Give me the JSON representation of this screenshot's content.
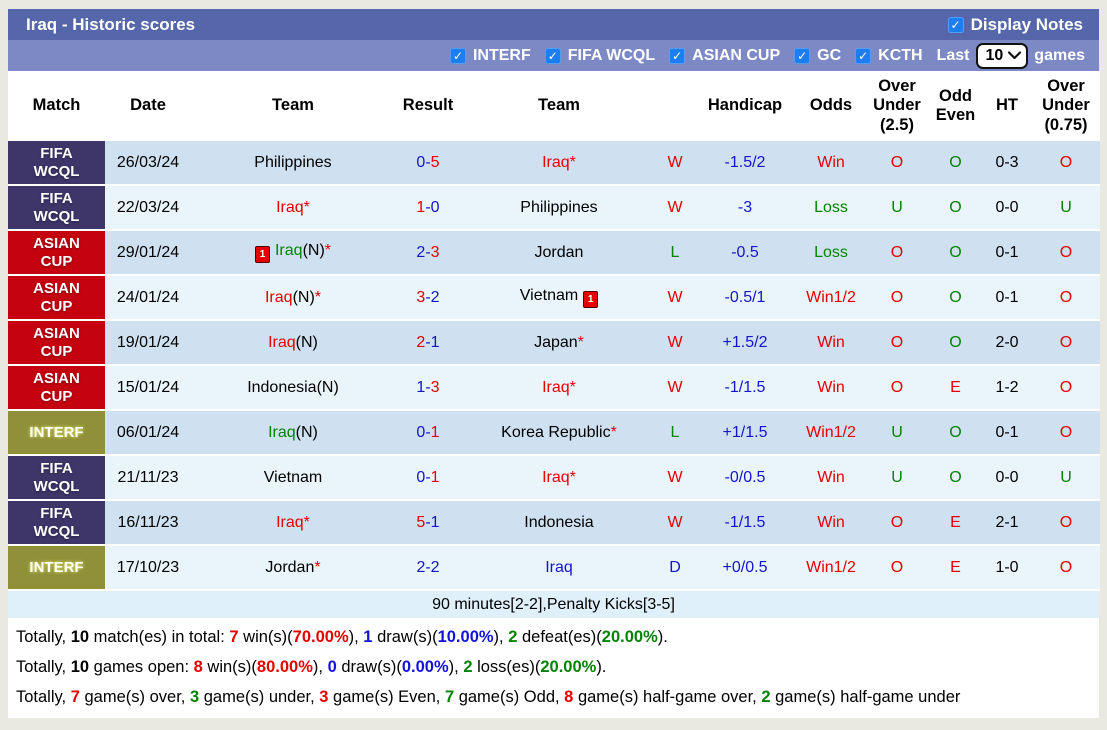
{
  "header": {
    "title": "Iraq - Historic scores",
    "display_notes_label": "Display Notes",
    "display_notes_checked": true
  },
  "filters": {
    "competitions": [
      "INTERF",
      "FIFA WCQL",
      "ASIAN CUP",
      "GC",
      "KCTH"
    ],
    "all_checked": true,
    "last_label": "Last",
    "last_value": "10",
    "games_label": "games"
  },
  "colors": {
    "win_red": "#e50000",
    "loss_green": "#028402",
    "draw_blue": "#1414c8",
    "badge_fifa_wcql": "#3e3569",
    "badge_asian_cup": "#c50210",
    "badge_interf": "#8f9039",
    "title_bar": "#5567aa",
    "filter_bar": "#7d89c5",
    "row_dark": "#cfe1f1",
    "row_light": "#e9f4fb",
    "checkbox_blue": "#1d7ef2"
  },
  "icons": {
    "red_card_text": "1",
    "checkbox_check": "✓"
  },
  "table": {
    "columns": [
      "Match",
      "Date",
      "Team",
      "Result",
      "Team",
      "",
      "Handicap",
      "Odds",
      "Over Under (2.5)",
      "Odd Even",
      "HT",
      "Over Under (0.75)"
    ],
    "note": "90 minutes[2-2],Penalty Kicks[3-5]",
    "rows": [
      {
        "comp_type": "fifa",
        "comp_lines": [
          "FIFA",
          "WCQL"
        ],
        "date": "26/03/24",
        "home": [
          {
            "t": "Philippines",
            "c": "k"
          }
        ],
        "home_icon": false,
        "result": [
          {
            "t": "0-",
            "c": "b"
          },
          {
            "t": "5",
            "c": "r"
          }
        ],
        "away": [
          {
            "t": "Iraq",
            "c": "r"
          },
          {
            "t": "*",
            "c": "r"
          }
        ],
        "away_icon": false,
        "wdl": {
          "t": "W",
          "c": "r"
        },
        "handicap": "-1.5/2",
        "odds": {
          "t": "Win",
          "c": "r"
        },
        "ou25": {
          "t": "O",
          "c": "r"
        },
        "oe": {
          "t": "O",
          "c": "g"
        },
        "ht": "0-3",
        "ou075": {
          "t": "O",
          "c": "r"
        }
      },
      {
        "comp_type": "fifa",
        "comp_lines": [
          "FIFA",
          "WCQL"
        ],
        "date": "22/03/24",
        "home": [
          {
            "t": "Iraq",
            "c": "r"
          },
          {
            "t": "*",
            "c": "r"
          }
        ],
        "home_icon": false,
        "result": [
          {
            "t": "1",
            "c": "r"
          },
          {
            "t": "-0",
            "c": "b"
          }
        ],
        "away": [
          {
            "t": "Philippines",
            "c": "k"
          }
        ],
        "away_icon": false,
        "wdl": {
          "t": "W",
          "c": "r"
        },
        "handicap": "-3",
        "odds": {
          "t": "Loss",
          "c": "g"
        },
        "ou25": {
          "t": "U",
          "c": "g"
        },
        "oe": {
          "t": "O",
          "c": "g"
        },
        "ht": "0-0",
        "ou075": {
          "t": "U",
          "c": "g"
        }
      },
      {
        "comp_type": "asian",
        "comp_lines": [
          "ASIAN",
          "CUP"
        ],
        "date": "29/01/24",
        "home": [
          {
            "t": "Iraq",
            "c": "g"
          },
          {
            "t": "(N)",
            "c": "k"
          },
          {
            "t": "*",
            "c": "r"
          }
        ],
        "home_icon": true,
        "result": [
          {
            "t": "2-",
            "c": "b"
          },
          {
            "t": "3",
            "c": "r"
          }
        ],
        "away": [
          {
            "t": "Jordan",
            "c": "k"
          }
        ],
        "away_icon": false,
        "wdl": {
          "t": "L",
          "c": "g"
        },
        "handicap": "-0.5",
        "odds": {
          "t": "Loss",
          "c": "g"
        },
        "ou25": {
          "t": "O",
          "c": "r"
        },
        "oe": {
          "t": "O",
          "c": "g"
        },
        "ht": "0-1",
        "ou075": {
          "t": "O",
          "c": "r"
        }
      },
      {
        "comp_type": "asian",
        "comp_lines": [
          "ASIAN",
          "CUP"
        ],
        "date": "24/01/24",
        "home": [
          {
            "t": "Iraq",
            "c": "r"
          },
          {
            "t": "(N)",
            "c": "k"
          },
          {
            "t": "*",
            "c": "r"
          }
        ],
        "home_icon": false,
        "result": [
          {
            "t": "3",
            "c": "r"
          },
          {
            "t": "-2",
            "c": "b"
          }
        ],
        "away": [
          {
            "t": "Vietnam",
            "c": "k"
          }
        ],
        "away_icon": true,
        "wdl": {
          "t": "W",
          "c": "r"
        },
        "handicap": "-0.5/1",
        "odds": {
          "t": "Win1/2",
          "c": "r"
        },
        "ou25": {
          "t": "O",
          "c": "r"
        },
        "oe": {
          "t": "O",
          "c": "g"
        },
        "ht": "0-1",
        "ou075": {
          "t": "O",
          "c": "r"
        }
      },
      {
        "comp_type": "asian",
        "comp_lines": [
          "ASIAN",
          "CUP"
        ],
        "date": "19/01/24",
        "home": [
          {
            "t": "Iraq",
            "c": "r"
          },
          {
            "t": "(N)",
            "c": "k"
          }
        ],
        "home_icon": false,
        "result": [
          {
            "t": "2",
            "c": "r"
          },
          {
            "t": "-1",
            "c": "b"
          }
        ],
        "away": [
          {
            "t": "Japan",
            "c": "k"
          },
          {
            "t": "*",
            "c": "r"
          }
        ],
        "away_icon": false,
        "wdl": {
          "t": "W",
          "c": "r"
        },
        "handicap": "+1.5/2",
        "odds": {
          "t": "Win",
          "c": "r"
        },
        "ou25": {
          "t": "O",
          "c": "r"
        },
        "oe": {
          "t": "O",
          "c": "g"
        },
        "ht": "2-0",
        "ou075": {
          "t": "O",
          "c": "r"
        }
      },
      {
        "comp_type": "asian",
        "comp_lines": [
          "ASIAN",
          "CUP"
        ],
        "date": "15/01/24",
        "home": [
          {
            "t": "Indonesia(N)",
            "c": "k"
          }
        ],
        "home_icon": false,
        "result": [
          {
            "t": "1-",
            "c": "b"
          },
          {
            "t": "3",
            "c": "r"
          }
        ],
        "away": [
          {
            "t": "Iraq",
            "c": "r"
          },
          {
            "t": "*",
            "c": "r"
          }
        ],
        "away_icon": false,
        "wdl": {
          "t": "W",
          "c": "r"
        },
        "handicap": "-1/1.5",
        "odds": {
          "t": "Win",
          "c": "r"
        },
        "ou25": {
          "t": "O",
          "c": "r"
        },
        "oe": {
          "t": "E",
          "c": "r"
        },
        "ht": "1-2",
        "ou075": {
          "t": "O",
          "c": "r"
        }
      },
      {
        "comp_type": "interf",
        "comp_lines": [
          "INTERF"
        ],
        "date": "06/01/24",
        "home": [
          {
            "t": "Iraq",
            "c": "g"
          },
          {
            "t": "(N)",
            "c": "k"
          }
        ],
        "home_icon": false,
        "result": [
          {
            "t": "0-",
            "c": "b"
          },
          {
            "t": "1",
            "c": "r"
          }
        ],
        "away": [
          {
            "t": "Korea Republic",
            "c": "k"
          },
          {
            "t": "*",
            "c": "r"
          }
        ],
        "away_icon": false,
        "wdl": {
          "t": "L",
          "c": "g"
        },
        "handicap": "+1/1.5",
        "odds": {
          "t": "Win1/2",
          "c": "r"
        },
        "ou25": {
          "t": "U",
          "c": "g"
        },
        "oe": {
          "t": "O",
          "c": "g"
        },
        "ht": "0-1",
        "ou075": {
          "t": "O",
          "c": "r"
        }
      },
      {
        "comp_type": "fifa",
        "comp_lines": [
          "FIFA",
          "WCQL"
        ],
        "date": "21/11/23",
        "home": [
          {
            "t": "Vietnam",
            "c": "k"
          }
        ],
        "home_icon": false,
        "result": [
          {
            "t": "0-",
            "c": "b"
          },
          {
            "t": "1",
            "c": "r"
          }
        ],
        "away": [
          {
            "t": "Iraq",
            "c": "r"
          },
          {
            "t": "*",
            "c": "r"
          }
        ],
        "away_icon": false,
        "wdl": {
          "t": "W",
          "c": "r"
        },
        "handicap": "-0/0.5",
        "odds": {
          "t": "Win",
          "c": "r"
        },
        "ou25": {
          "t": "U",
          "c": "g"
        },
        "oe": {
          "t": "O",
          "c": "g"
        },
        "ht": "0-0",
        "ou075": {
          "t": "U",
          "c": "g"
        }
      },
      {
        "comp_type": "fifa",
        "comp_lines": [
          "FIFA",
          "WCQL"
        ],
        "date": "16/11/23",
        "home": [
          {
            "t": "Iraq",
            "c": "r"
          },
          {
            "t": "*",
            "c": "r"
          }
        ],
        "home_icon": false,
        "result": [
          {
            "t": "5",
            "c": "r"
          },
          {
            "t": "-1",
            "c": "b"
          }
        ],
        "away": [
          {
            "t": "Indonesia",
            "c": "k"
          }
        ],
        "away_icon": false,
        "wdl": {
          "t": "W",
          "c": "r"
        },
        "handicap": "-1/1.5",
        "odds": {
          "t": "Win",
          "c": "r"
        },
        "ou25": {
          "t": "O",
          "c": "r"
        },
        "oe": {
          "t": "E",
          "c": "r"
        },
        "ht": "2-1",
        "ou075": {
          "t": "O",
          "c": "r"
        }
      },
      {
        "comp_type": "interf",
        "comp_lines": [
          "INTERF"
        ],
        "date": "17/10/23",
        "home": [
          {
            "t": "Jordan",
            "c": "k"
          },
          {
            "t": "*",
            "c": "r"
          }
        ],
        "home_icon": false,
        "result": [
          {
            "t": "2-2",
            "c": "b"
          }
        ],
        "away": [
          {
            "t": "Iraq",
            "c": "b"
          }
        ],
        "away_icon": false,
        "wdl": {
          "t": "D",
          "c": "b"
        },
        "handicap": "+0/0.5",
        "odds": {
          "t": "Win1/2",
          "c": "r"
        },
        "ou25": {
          "t": "O",
          "c": "r"
        },
        "oe": {
          "t": "E",
          "c": "r"
        },
        "ht": "1-0",
        "ou075": {
          "t": "O",
          "c": "r"
        }
      }
    ]
  },
  "summary": {
    "line1": [
      {
        "t": "Totally, ",
        "c": "k"
      },
      {
        "t": "10",
        "c": "kb"
      },
      {
        "t": " match(es) in total: ",
        "c": "k"
      },
      {
        "t": "7",
        "c": "rb"
      },
      {
        "t": " win(s)(",
        "c": "k"
      },
      {
        "t": "70.00%",
        "c": "rb"
      },
      {
        "t": "), ",
        "c": "k"
      },
      {
        "t": "1",
        "c": "bb"
      },
      {
        "t": " draw(s)(",
        "c": "k"
      },
      {
        "t": "10.00%",
        "c": "bb"
      },
      {
        "t": "), ",
        "c": "k"
      },
      {
        "t": "2",
        "c": "gb"
      },
      {
        "t": " defeat(es)(",
        "c": "k"
      },
      {
        "t": "20.00%",
        "c": "gb"
      },
      {
        "t": ").",
        "c": "k"
      }
    ],
    "line2": [
      {
        "t": "Totally, ",
        "c": "k"
      },
      {
        "t": "10",
        "c": "kb"
      },
      {
        "t": " games open: ",
        "c": "k"
      },
      {
        "t": "8",
        "c": "rb"
      },
      {
        "t": " win(s)(",
        "c": "k"
      },
      {
        "t": "80.00%",
        "c": "rb"
      },
      {
        "t": "), ",
        "c": "k"
      },
      {
        "t": "0",
        "c": "bb"
      },
      {
        "t": " draw(s)(",
        "c": "k"
      },
      {
        "t": "0.00%",
        "c": "bb"
      },
      {
        "t": "), ",
        "c": "k"
      },
      {
        "t": "2",
        "c": "gb"
      },
      {
        "t": " loss(es)(",
        "c": "k"
      },
      {
        "t": "20.00%",
        "c": "gb"
      },
      {
        "t": ").",
        "c": "k"
      }
    ],
    "line3": [
      {
        "t": "Totally, ",
        "c": "k"
      },
      {
        "t": "7",
        "c": "rb"
      },
      {
        "t": " game(s) over, ",
        "c": "k"
      },
      {
        "t": "3",
        "c": "gb"
      },
      {
        "t": " game(s) under, ",
        "c": "k"
      },
      {
        "t": "3",
        "c": "rb"
      },
      {
        "t": " game(s) Even, ",
        "c": "k"
      },
      {
        "t": "7",
        "c": "gb"
      },
      {
        "t": " game(s) Odd, ",
        "c": "k"
      },
      {
        "t": "8",
        "c": "rb"
      },
      {
        "t": " game(s) half-game over, ",
        "c": "k"
      },
      {
        "t": "2",
        "c": "gb"
      },
      {
        "t": " game(s) half-game under",
        "c": "k"
      }
    ]
  }
}
